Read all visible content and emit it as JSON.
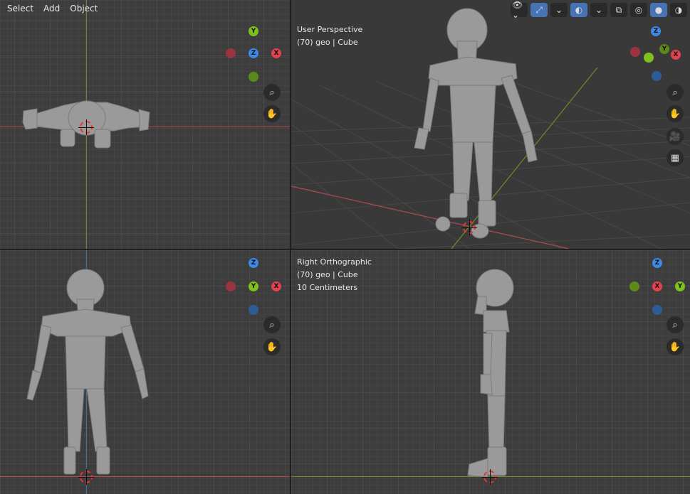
{
  "menu": {
    "select": "Select",
    "add": "Add",
    "object": "Object"
  },
  "viewports": {
    "user": {
      "title": "User Perspective",
      "object": "(70) geo | Cube"
    },
    "right": {
      "title": "Right Orthographic",
      "object": "(70) geo | Cube",
      "scale": "10 Centimeters"
    }
  },
  "gizmo_labels": {
    "x": "X",
    "y": "Y",
    "z": "Z"
  },
  "colors": {
    "x": "#e2424f",
    "y": "#7fc01b",
    "z": "#3d89e6",
    "x_neg": "#9c3340",
    "y_neg": "#5c8a1a",
    "z_neg": "#2d5d99",
    "active": "#4772b3"
  },
  "icons": [
    "eye-icon",
    "select-arrows-icon",
    "overlay-icon",
    "xray-icon",
    "shading-wire-icon",
    "shading-solid-icon",
    "shading-material-icon",
    "shading-render-icon",
    "zoom-icon",
    "pan-hand-icon",
    "camera-icon",
    "grid-icon"
  ]
}
